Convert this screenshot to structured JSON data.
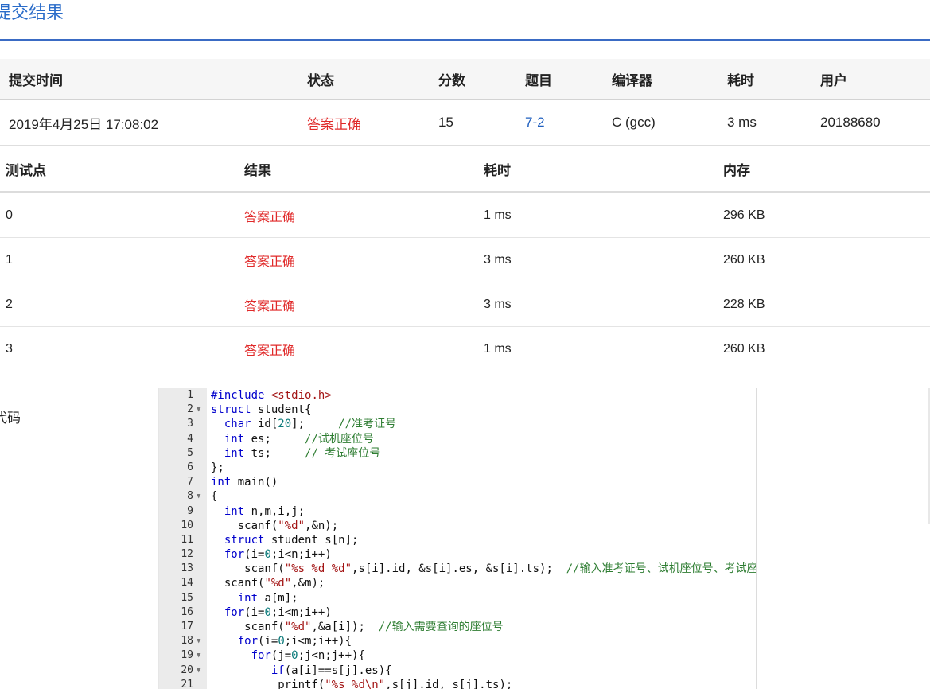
{
  "page": {
    "title": "提交结果",
    "code_label": "代码"
  },
  "summary": {
    "headers": [
      "提交时间",
      "状态",
      "分数",
      "题目",
      "编译器",
      "耗时",
      "用户"
    ],
    "row": {
      "time": "2019年4月25日 17:08:02",
      "status": "答案正确",
      "score": "15",
      "problem": "7-2",
      "compiler": "C (gcc)",
      "elapsed": "3 ms",
      "user": "20188680"
    }
  },
  "cases": {
    "headers": [
      "测试点",
      "结果",
      "耗时",
      "内存"
    ],
    "rows": [
      {
        "id": "0",
        "result": "答案正确",
        "time": "1 ms",
        "memory": "296 KB"
      },
      {
        "id": "1",
        "result": "答案正确",
        "time": "3 ms",
        "memory": "260 KB"
      },
      {
        "id": "2",
        "result": "答案正确",
        "time": "3 ms",
        "memory": "228 KB"
      },
      {
        "id": "3",
        "result": "答案正确",
        "time": "1 ms",
        "memory": "260 KB"
      }
    ]
  },
  "code": {
    "lines": [
      {
        "n": "1",
        "fold": "",
        "text": "#include <stdio.h>"
      },
      {
        "n": "2",
        "fold": "▼",
        "text": "struct student{"
      },
      {
        "n": "3",
        "fold": "",
        "text": "  char id[20];     //准考证号"
      },
      {
        "n": "4",
        "fold": "",
        "text": "  int es;     //试机座位号"
      },
      {
        "n": "5",
        "fold": "",
        "text": "  int ts;     // 考试座位号"
      },
      {
        "n": "6",
        "fold": "",
        "text": "};"
      },
      {
        "n": "7",
        "fold": "",
        "text": "int main()"
      },
      {
        "n": "8",
        "fold": "▼",
        "text": "{"
      },
      {
        "n": "9",
        "fold": "",
        "text": "  int n,m,i,j;"
      },
      {
        "n": "10",
        "fold": "",
        "text": "    scanf(\"%d\",&n);"
      },
      {
        "n": "11",
        "fold": "",
        "text": "  struct student s[n];"
      },
      {
        "n": "12",
        "fold": "",
        "text": "  for(i=0;i<n;i++)"
      },
      {
        "n": "13",
        "fold": "",
        "text": "     scanf(\"%s %d %d\",s[i].id, &s[i].es, &s[i].ts);  //输入准考证号、试机座位号、考试座位号"
      },
      {
        "n": "14",
        "fold": "",
        "text": "  scanf(\"%d\",&m);"
      },
      {
        "n": "15",
        "fold": "",
        "text": "    int a[m];"
      },
      {
        "n": "16",
        "fold": "",
        "text": "  for(i=0;i<m;i++)"
      },
      {
        "n": "17",
        "fold": "",
        "text": "     scanf(\"%d\",&a[i]);  //输入需要查询的座位号"
      },
      {
        "n": "18",
        "fold": "▼",
        "text": "    for(i=0;i<m;i++){"
      },
      {
        "n": "19",
        "fold": "▼",
        "text": "      for(j=0;j<n;j++){"
      },
      {
        "n": "20",
        "fold": "▼",
        "text": "         if(a[i]==s[j].es){"
      },
      {
        "n": "21",
        "fold": "",
        "text": "          printf(\"%s %d\\n\",s[j].id, s[j].ts);"
      }
    ]
  },
  "colors": {
    "title": "#2a6cc9",
    "accept": "#e02a2a",
    "link": "#1f5fbf"
  }
}
